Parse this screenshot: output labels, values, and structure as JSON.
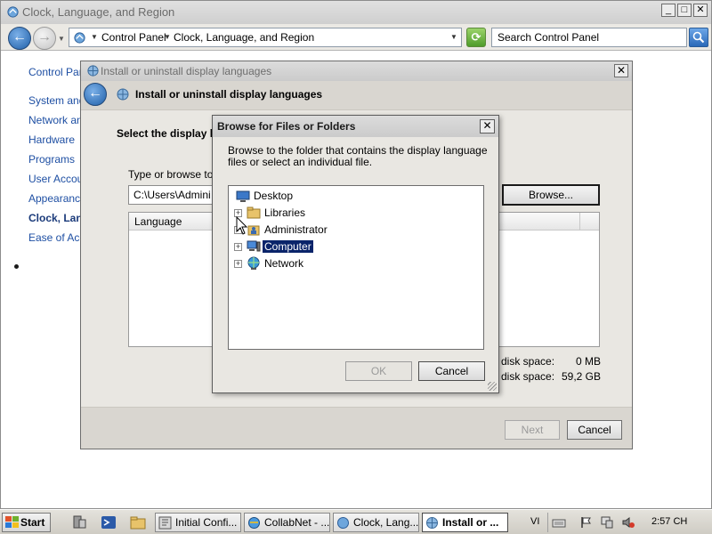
{
  "main_window": {
    "title": "Clock, Language, and Region",
    "buttons": {
      "minimize": "_",
      "maximize": "□",
      "close": "✕"
    },
    "address": {
      "crumbs": [
        "Control Panel",
        "Clock, Language, and Region"
      ]
    },
    "search": {
      "placeholder": "Search Control Panel"
    },
    "left_nav": {
      "items": [
        {
          "label": "Control Panel Home"
        },
        {
          "label": "System and Security"
        },
        {
          "label": "Network and Internet"
        },
        {
          "label": "Hardware"
        },
        {
          "label": "Programs"
        },
        {
          "label": "User Accounts"
        },
        {
          "label": "Appearance"
        },
        {
          "label": "Clock, Language, and Region"
        },
        {
          "label": "Ease of Access"
        }
      ],
      "current_index": 7
    }
  },
  "install_dialog": {
    "title": "Install or uninstall display languages",
    "header": "Install or uninstall display languages",
    "close": "✕",
    "heading": "Select the display l",
    "type_label": "Type or browse to",
    "path_value": "C:\\Users\\Admini",
    "browse_label": "Browse...",
    "language_column": "Language",
    "space_rows": [
      {
        "label": "disk space:",
        "value": "0 MB"
      },
      {
        "label": "disk space:",
        "value": "59,2 GB"
      }
    ],
    "next_label": "Next",
    "cancel_label": "Cancel"
  },
  "browse_dialog": {
    "title": "Browse for Files or Folders",
    "close": "✕",
    "instructions": "Browse to the folder that contains the display language files or select an individual file.",
    "tree": [
      {
        "label": "Desktop",
        "expandable": false,
        "selected": false,
        "icon": "desktop-icon"
      },
      {
        "label": "Libraries",
        "expandable": true,
        "selected": false,
        "icon": "libraries-icon"
      },
      {
        "label": "Administrator",
        "expandable": true,
        "selected": false,
        "icon": "user-folder-icon"
      },
      {
        "label": "Computer",
        "expandable": true,
        "selected": true,
        "icon": "computer-icon"
      },
      {
        "label": "Network",
        "expandable": true,
        "selected": false,
        "icon": "network-icon"
      }
    ],
    "expander_glyph": "+",
    "ok_label": "OK",
    "cancel_label": "Cancel"
  },
  "taskbar": {
    "start_label": "Start",
    "tasks": [
      {
        "label": "Initial Confi...",
        "active": false
      },
      {
        "label": "CollabNet - ...",
        "active": false
      },
      {
        "label": "Clock, Lang...",
        "active": false
      },
      {
        "label": "Install or ...",
        "active": true
      }
    ],
    "language": "VI",
    "clock": "2:57 CH"
  },
  "colors": {
    "selection": "#0a246a",
    "link": "#1e4fa3",
    "dialog_face": "#e9e7e2"
  }
}
